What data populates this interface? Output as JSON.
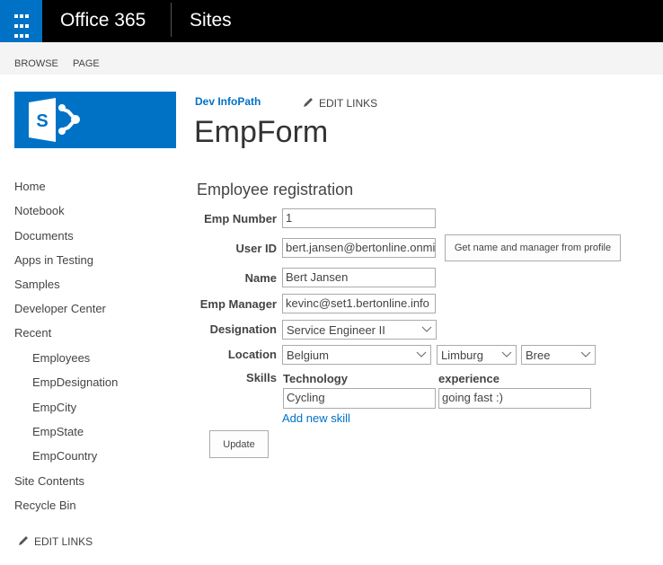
{
  "topbar": {
    "app_title": "Office 365",
    "section": "Sites",
    "waffle_icon": "app-launcher-icon"
  },
  "ribbon": {
    "tabs": [
      "BROWSE",
      "PAGE"
    ]
  },
  "header": {
    "site_link": "Dev InfoPath",
    "edit_links": "EDIT LINKS",
    "page_title": "EmpForm"
  },
  "nav": {
    "items": [
      {
        "label": "Home"
      },
      {
        "label": "Notebook"
      },
      {
        "label": "Documents"
      },
      {
        "label": "Apps in Testing"
      },
      {
        "label": "Samples"
      },
      {
        "label": "Developer Center"
      },
      {
        "label": "Recent"
      },
      {
        "label": "Employees"
      },
      {
        "label": "EmpDesignation"
      },
      {
        "label": "EmpCity"
      },
      {
        "label": "EmpState"
      },
      {
        "label": "EmpCountry"
      },
      {
        "label": "Site Contents"
      },
      {
        "label": "Recycle Bin"
      }
    ],
    "edit_links": "EDIT LINKS"
  },
  "form": {
    "heading": "Employee registration",
    "emp_number": {
      "label": "Emp Number",
      "value": "1"
    },
    "user_id": {
      "label": "User ID",
      "value": "bert.jansen@bertonline.onmi"
    },
    "profile_button": "Get name and manager from profile",
    "name": {
      "label": "Name",
      "value": "Bert Jansen"
    },
    "emp_manager": {
      "label": "Emp Manager",
      "value": "kevinc@set1.bertonline.info"
    },
    "designation": {
      "label": "Designation",
      "value": "Service Engineer II"
    },
    "location": {
      "label": "Location",
      "country": "Belgium",
      "state": "Limburg",
      "city": "Bree"
    },
    "skills": {
      "label": "Skills",
      "col_technology": "Technology",
      "col_experience": "experience",
      "rows": [
        {
          "technology": "Cycling",
          "experience": "going fast :)"
        }
      ],
      "add_link": "Add new skill"
    },
    "update_button": "Update"
  },
  "colors": {
    "accent": "#0072c6",
    "topbar": "#000000",
    "ribbon": "#f4f4f4"
  }
}
